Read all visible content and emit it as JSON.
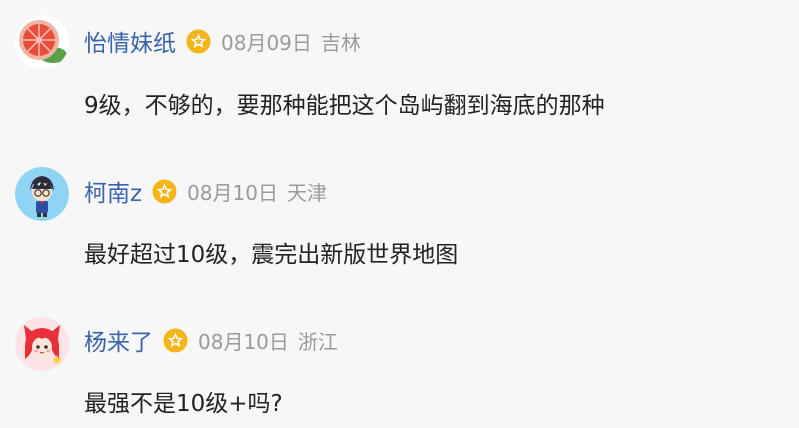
{
  "comments": [
    {
      "username": "怡情妹纸",
      "badge_icon": "vip-star-badge-icon",
      "avatar_icon": "grapefruit-avatar-icon",
      "date": "08月09日",
      "location": "吉林",
      "content": "9级，不够的，要那种能把这个岛屿翻到海底的那种"
    },
    {
      "username": "柯南z",
      "badge_icon": "vip-star-badge-icon",
      "avatar_icon": "conan-avatar-icon",
      "date": "08月10日",
      "location": "天津",
      "content": "最好超过10级，震完出新版世界地图"
    },
    {
      "username": "杨来了",
      "badge_icon": "vip-star-badge-icon",
      "avatar_icon": "devil-girl-avatar-icon",
      "date": "08月10日",
      "location": "浙江",
      "content": "最强不是10级+吗?"
    }
  ],
  "colors": {
    "username": "#3a63ad",
    "meta_gray": "#9a9a9a",
    "content_text": "#222222",
    "badge_gold": "#f5b418",
    "background": "#f7f7f8"
  }
}
